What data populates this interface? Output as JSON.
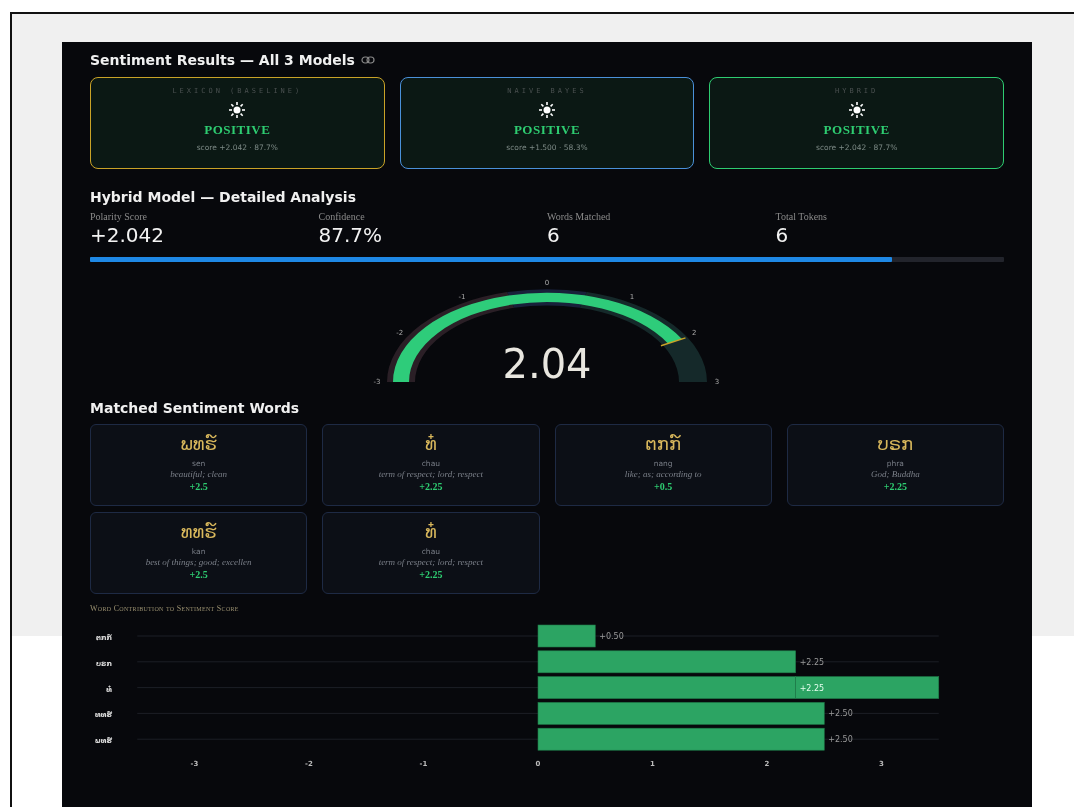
{
  "results": {
    "title": "Sentiment Results — All 3 Models",
    "models": [
      {
        "name": "LEXICON (BASELINE)",
        "label": "POSITIVE",
        "score": "score +2.042 · 87.7%",
        "color": "#c9a227"
      },
      {
        "name": "NAIVE BAYES",
        "label": "POSITIVE",
        "score": "score +1.500 · 58.3%",
        "color": "#4a90d9"
      },
      {
        "name": "HYBRID",
        "label": "POSITIVE",
        "score": "score +2.042 · 87.7%",
        "color": "#2ecc71"
      }
    ]
  },
  "analysis": {
    "title": "Hybrid Model — Detailed Analysis",
    "metrics": [
      {
        "label": "Polarity Score",
        "value": "+2.042"
      },
      {
        "label": "Confidence",
        "value": "87.7%"
      },
      {
        "label": "Words Matched",
        "value": "6"
      },
      {
        "label": "Total Tokens",
        "value": "6"
      }
    ],
    "confidence_bar": {
      "level": 0.877
    },
    "gauge": {
      "value": "2.04",
      "ticks": [
        "-3",
        "-2",
        "-1",
        "0",
        "1",
        "2",
        "3"
      ]
    }
  },
  "words": {
    "title": "Matched Sentiment Words",
    "items": [
      {
        "word": "ພທຮ໌",
        "roman": "sen",
        "meaning": "beautiful; clean",
        "score": "+2.5"
      },
      {
        "word": "ທ໋",
        "roman": "chau",
        "meaning": "term of respect; lord; respect",
        "score": "+2.25"
      },
      {
        "word": "ຕກກ໌",
        "roman": "nang",
        "meaning": "like; as; according to",
        "score": "+0.5"
      },
      {
        "word": "ບຣກ",
        "roman": "phra",
        "meaning": "God; Buddha",
        "score": "+2.25"
      },
      {
        "word": "ທທຮ໌",
        "roman": "kan",
        "meaning": "best of things; good; excellen",
        "score": "+2.5"
      },
      {
        "word": "ທ໋",
        "roman": "chau",
        "meaning": "term of respect; lord; respect",
        "score": "+2.25"
      }
    ]
  },
  "contribution": {
    "chart_data": {
      "type": "bar",
      "title": "Word Contribution to Sentiment Score",
      "orientation": "horizontal",
      "stacked": true,
      "categories": [
        "ຕກກ໌",
        "ບຣກ",
        "ທ໋",
        "ທທຮ໌",
        "ພທຮ໌"
      ],
      "series": [
        {
          "color": "#2ca463",
          "values": [
            0.5,
            2.25,
            2.25,
            2.5,
            2.5
          ]
        },
        {
          "color": "#2ca463",
          "values": [
            null,
            null,
            1.25,
            null,
            null
          ]
        }
      ],
      "xlim": [
        -3.5,
        3.5
      ],
      "xticks": [
        -3,
        -2,
        -1,
        0,
        1,
        2,
        3
      ],
      "value_labels": [
        "+0.50",
        "+2.25",
        "+2.25",
        "+2.50",
        "+2.50"
      ]
    }
  }
}
